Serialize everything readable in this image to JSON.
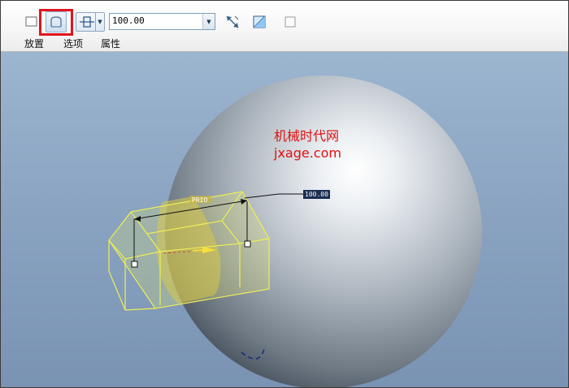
{
  "dashboard": {
    "tabs": [
      {
        "label": "放置"
      },
      {
        "label": "选项"
      },
      {
        "label": "属性"
      }
    ],
    "depth_value": "100.00",
    "tools": {
      "plane_extrude": "extrude-plane-icon",
      "surface_extrude": "extrude-surface-icon",
      "depth_option": "blind-depth-icon",
      "flip_direction": "flip-direction-icon",
      "remove_material": "remove-material-icon",
      "thicken": "thicken-sketch-icon"
    },
    "highlight_color": "#e0151d"
  },
  "viewport": {
    "watermark_line1": "机械时代网",
    "watermark_line2": "jxage.com",
    "dimension_value": "100.00",
    "trim_label": "PRIO",
    "colors": {
      "background_top": "#9cb6d0",
      "background_bottom": "#7a93b3",
      "preview": "#f2f25a",
      "watermark": "#e01010"
    }
  }
}
